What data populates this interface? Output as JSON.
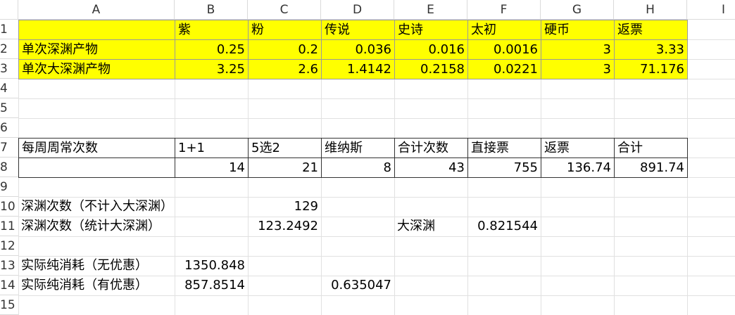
{
  "columns": [
    "A",
    "B",
    "C",
    "D",
    "E",
    "F",
    "G",
    "H",
    "I"
  ],
  "rows": [
    "1",
    "2",
    "3",
    "4",
    "5",
    "6",
    "7",
    "8",
    "9",
    "10",
    "11",
    "12",
    "13",
    "14",
    "15"
  ],
  "cells": {
    "B1": "紫",
    "C1": "粉",
    "D1": "传说",
    "E1": "史诗",
    "F1": "太初",
    "G1": "硬币",
    "H1": "返票",
    "A2": "单次深渊产物",
    "B2": "0.25",
    "C2": "0.2",
    "D2": "0.036",
    "E2": "0.016",
    "F2": "0.0016",
    "G2": "3",
    "H2": "3.33",
    "A3": "单次大深渊产物",
    "B3": "3.25",
    "C3": "2.6",
    "D3": "1.4142",
    "E3": "0.2158",
    "F3": "0.0221",
    "G3": "3",
    "H3": "71.176",
    "A7": "每周周常次数",
    "B7": "1+1",
    "C7": "5选2",
    "D7": "维纳斯",
    "E7": "合计次数",
    "F7": "直接票",
    "G7": "返票",
    "H7": "合计",
    "B8": "14",
    "C8": "21",
    "D8": "8",
    "E8": "43",
    "F8": "755",
    "G8": "136.74",
    "H8": "891.74",
    "A10": "深渊次数（不计入大深渊）",
    "C10": "129",
    "A11": "深渊次数（统计大深渊）",
    "C11": "123.2492",
    "E11": "大深渊",
    "F11": "0.821544",
    "A13": "实际纯消耗（无优惠）",
    "B13": "1350.848",
    "A14": "实际纯消耗（有优惠）",
    "B14": "857.8514",
    "D14": "0.635047"
  }
}
